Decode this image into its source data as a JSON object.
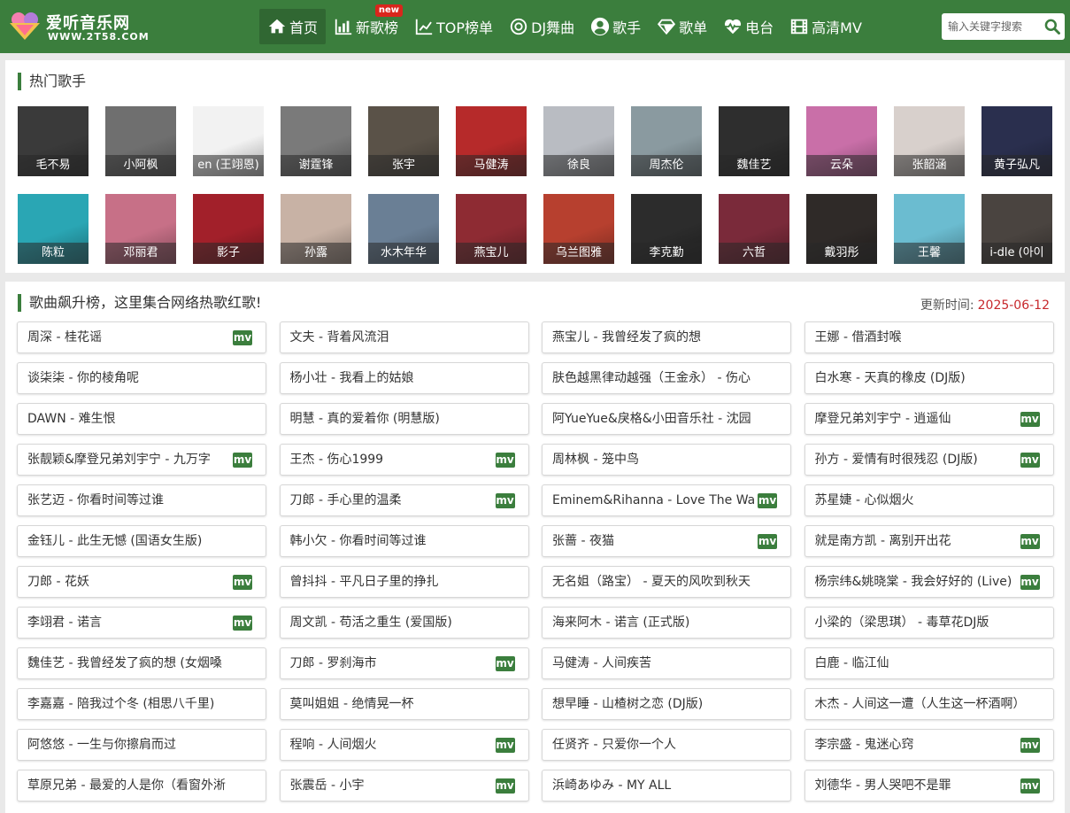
{
  "header": {
    "logo_title": "爱听音乐网",
    "logo_url": "WWW.2T58.COM",
    "nav": [
      {
        "label": "首页",
        "icon": "home-icon",
        "active": true
      },
      {
        "label": "新歌榜",
        "icon": "bar-chart-icon",
        "badge": "new"
      },
      {
        "label": "TOP榜单",
        "icon": "trend-icon"
      },
      {
        "label": "DJ舞曲",
        "icon": "disc-icon"
      },
      {
        "label": "歌手",
        "icon": "user-icon"
      },
      {
        "label": "歌单",
        "icon": "diamond-icon"
      },
      {
        "label": "电台",
        "icon": "heartbeat-icon"
      },
      {
        "label": "高清MV",
        "icon": "film-icon"
      }
    ],
    "search_placeholder": "输入关键字搜索"
  },
  "singers_section": {
    "title": "热门歌手",
    "singers": [
      {
        "name": "毛不易",
        "color": "#3a3a3a"
      },
      {
        "name": "小阿枫",
        "color": "#6f6f6f"
      },
      {
        "name": "en (王翊恩)",
        "color": "#f2f2f2"
      },
      {
        "name": "谢霆锋",
        "color": "#7a7a7a"
      },
      {
        "name": "张宇",
        "color": "#5a5248"
      },
      {
        "name": "马健涛",
        "color": "#b62a2a"
      },
      {
        "name": "徐良",
        "color": "#b9bcc2"
      },
      {
        "name": "周杰伦",
        "color": "#8a9aa0"
      },
      {
        "name": "魏佳艺",
        "color": "#2e2e2e"
      },
      {
        "name": "云朵",
        "color": "#c96fa8"
      },
      {
        "name": "张韶涵",
        "color": "#d8d0cc"
      },
      {
        "name": "黄子弘凡",
        "color": "#2a2f4e"
      },
      {
        "name": "陈粒",
        "color": "#2aa6b4"
      },
      {
        "name": "邓丽君",
        "color": "#c77087"
      },
      {
        "name": "影子",
        "color": "#a2202a"
      },
      {
        "name": "孙露",
        "color": "#c8b2a5"
      },
      {
        "name": "水木年华",
        "color": "#6a7f95"
      },
      {
        "name": "燕宝儿",
        "color": "#8e2b33"
      },
      {
        "name": "乌兰图雅",
        "color": "#b7402f"
      },
      {
        "name": "李克勤",
        "color": "#2c2c2c"
      },
      {
        "name": "六哲",
        "color": "#7a2a3a"
      },
      {
        "name": "戴羽彤",
        "color": "#2f2a28"
      },
      {
        "name": "王馨",
        "color": "#6bbcd0"
      },
      {
        "name": "i-dle (아이",
        "color": "#4a4440"
      }
    ]
  },
  "songs_section": {
    "title": "歌曲飙升榜，这里集合网络热歌红歌!",
    "update_label": "更新时间:",
    "update_date": "2025-06-12",
    "mv_label": "mv",
    "songs": [
      {
        "title": "周深 - 桂花谣",
        "mv": true
      },
      {
        "title": "文夫 - 背着风流泪",
        "mv": false
      },
      {
        "title": "燕宝儿 - 我曾经发了疯的想",
        "mv": false
      },
      {
        "title": "王娜 - 借酒封喉",
        "mv": false
      },
      {
        "title": "谈柒柒 - 你的棱角呢",
        "mv": false
      },
      {
        "title": "杨小壮 - 我看上的姑娘",
        "mv": false
      },
      {
        "title": "肤色越黑律动越强（王金永） - 伤心",
        "mv": false
      },
      {
        "title": "白水寒 - 天真的橡皮 (DJ版)",
        "mv": false
      },
      {
        "title": "DAWN - 难生恨",
        "mv": false
      },
      {
        "title": "明慧 - 真的爱着你 (明慧版)",
        "mv": false
      },
      {
        "title": "阿YueYue&戾格&小田音乐社 - 沈园",
        "mv": false
      },
      {
        "title": "摩登兄弟刘宇宁 - 逍遥仙",
        "mv": true
      },
      {
        "title": "张靓颖&摩登兄弟刘宇宁 - 九万字",
        "mv": true
      },
      {
        "title": "王杰 - 伤心1999",
        "mv": true
      },
      {
        "title": "周林枫 - 笼中鸟",
        "mv": false
      },
      {
        "title": "孙方 - 爱情有时很残忍 (DJ版)",
        "mv": true
      },
      {
        "title": "张艺迈 - 你看时间等过谁",
        "mv": false
      },
      {
        "title": "刀郎 - 手心里的温柔",
        "mv": true
      },
      {
        "title": "Eminem&Rihanna - Love The Way",
        "mv": true
      },
      {
        "title": "苏星婕 - 心似烟火",
        "mv": false
      },
      {
        "title": "金钰儿 - 此生无憾 (国语女生版)",
        "mv": false
      },
      {
        "title": "韩小欠 - 你看时间等过谁",
        "mv": false
      },
      {
        "title": "张蔷 - 夜猫",
        "mv": true
      },
      {
        "title": "就是南方凯 - 离别开出花",
        "mv": true
      },
      {
        "title": "刀郎 - 花妖",
        "mv": true
      },
      {
        "title": "曾抖抖 - 平凡日子里的挣扎",
        "mv": false
      },
      {
        "title": "无名姐（路宝） - 夏天的风吹到秋天",
        "mv": false
      },
      {
        "title": "杨宗纬&姚晓棠 - 我会好好的 (Live)",
        "mv": true
      },
      {
        "title": "李翊君 - 诺言",
        "mv": true
      },
      {
        "title": "周文凯 - 苟活之重生 (爱国版)",
        "mv": false
      },
      {
        "title": "海来阿木 - 诺言 (正式版)",
        "mv": false
      },
      {
        "title": "小梁的（梁思琪） - 毒草花DJ版",
        "mv": false
      },
      {
        "title": "魏佳艺 - 我曾经发了疯的想 (女烟嗓",
        "mv": false
      },
      {
        "title": "刀郎 - 罗刹海市",
        "mv": true
      },
      {
        "title": "马健涛 - 人间疾苦",
        "mv": false
      },
      {
        "title": "白鹿 - 临江仙",
        "mv": false
      },
      {
        "title": "李嘉嘉 - 陪我过个冬 (相思八千里)",
        "mv": false
      },
      {
        "title": "莫叫姐姐 - 绝情晃一杯",
        "mv": false
      },
      {
        "title": "想早睡 - 山楂树之恋 (DJ版)",
        "mv": false
      },
      {
        "title": "木杰 - 人间这一遭（人生这一杯酒啊）",
        "mv": false
      },
      {
        "title": "阿悠悠 - 一生与你擦肩而过",
        "mv": false
      },
      {
        "title": "程响 - 人间烟火",
        "mv": true
      },
      {
        "title": "任贤齐 - 只爱你一个人",
        "mv": false
      },
      {
        "title": "李宗盛 - 鬼迷心窍",
        "mv": true
      },
      {
        "title": "草原兄弟 - 最爱的人是你（看窗外淅",
        "mv": false
      },
      {
        "title": "张震岳 - 小宇",
        "mv": true
      },
      {
        "title": "浜崎あゆみ - MY ALL",
        "mv": false
      },
      {
        "title": "刘德华 - 男人哭吧不是罪",
        "mv": true
      }
    ]
  }
}
